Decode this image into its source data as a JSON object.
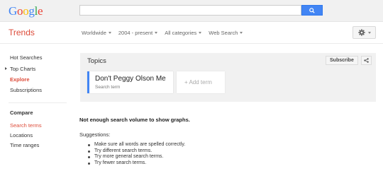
{
  "header": {
    "logo_letters": [
      "G",
      "o",
      "o",
      "g",
      "l",
      "e"
    ],
    "search_value": ""
  },
  "appbar": {
    "title": "Trends",
    "filters": [
      "Worldwide",
      "2004 - present",
      "All categories",
      "Web Search"
    ]
  },
  "sidebar": {
    "items": [
      {
        "label": "Hot Searches"
      },
      {
        "label": "Top Charts"
      },
      {
        "label": "Explore"
      },
      {
        "label": "Subscriptions"
      }
    ],
    "compare_title": "Compare",
    "compare_items": [
      {
        "label": "Search terms"
      },
      {
        "label": "Locations"
      },
      {
        "label": "Time ranges"
      }
    ]
  },
  "topics": {
    "title": "Topics",
    "subscribe_label": "Subscribe",
    "term_name": "Don't Peggy Olson Me",
    "term_type": "Search term",
    "add_term_label": "+ Add term"
  },
  "results": {
    "message": "Not enough search volume to show graphs.",
    "suggestions_title": "Suggestions:",
    "suggestions": [
      "Make sure all words are spelled correctly.",
      "Try different search terms.",
      "Try more general search terms.",
      "Try fewer search terms."
    ]
  },
  "colors": {
    "accent_red": "#dd4b39",
    "accent_blue": "#4285f4"
  },
  "icons": [
    "search-icon",
    "gear-icon",
    "share-icon",
    "expand-arrow-icon"
  ]
}
